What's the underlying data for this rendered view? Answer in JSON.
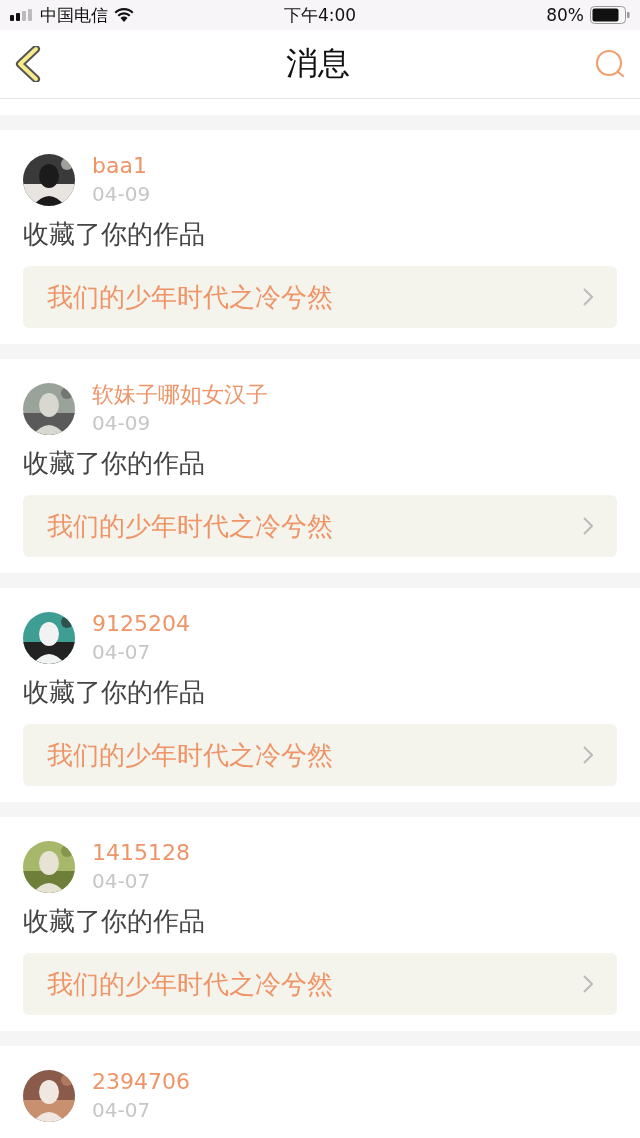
{
  "status_bar": {
    "carrier": "中国电信",
    "time": "下午4:00",
    "battery": "80%"
  },
  "nav": {
    "title": "消息"
  },
  "messages": [
    {
      "user": "baa1",
      "date": "04-09",
      "action": "收藏了你的作品",
      "work": "我们的少年时代之冷兮然"
    },
    {
      "user": "软妹子哪如女汉子",
      "date": "04-09",
      "action": "收藏了你的作品",
      "work": "我们的少年时代之冷兮然"
    },
    {
      "user": "9125204",
      "date": "04-07",
      "action": "收藏了你的作品",
      "work": "我们的少年时代之冷兮然"
    },
    {
      "user": "1415128",
      "date": "04-07",
      "action": "收藏了你的作品",
      "work": "我们的少年时代之冷兮然"
    },
    {
      "user": "2394706",
      "date": "04-07"
    }
  ]
}
